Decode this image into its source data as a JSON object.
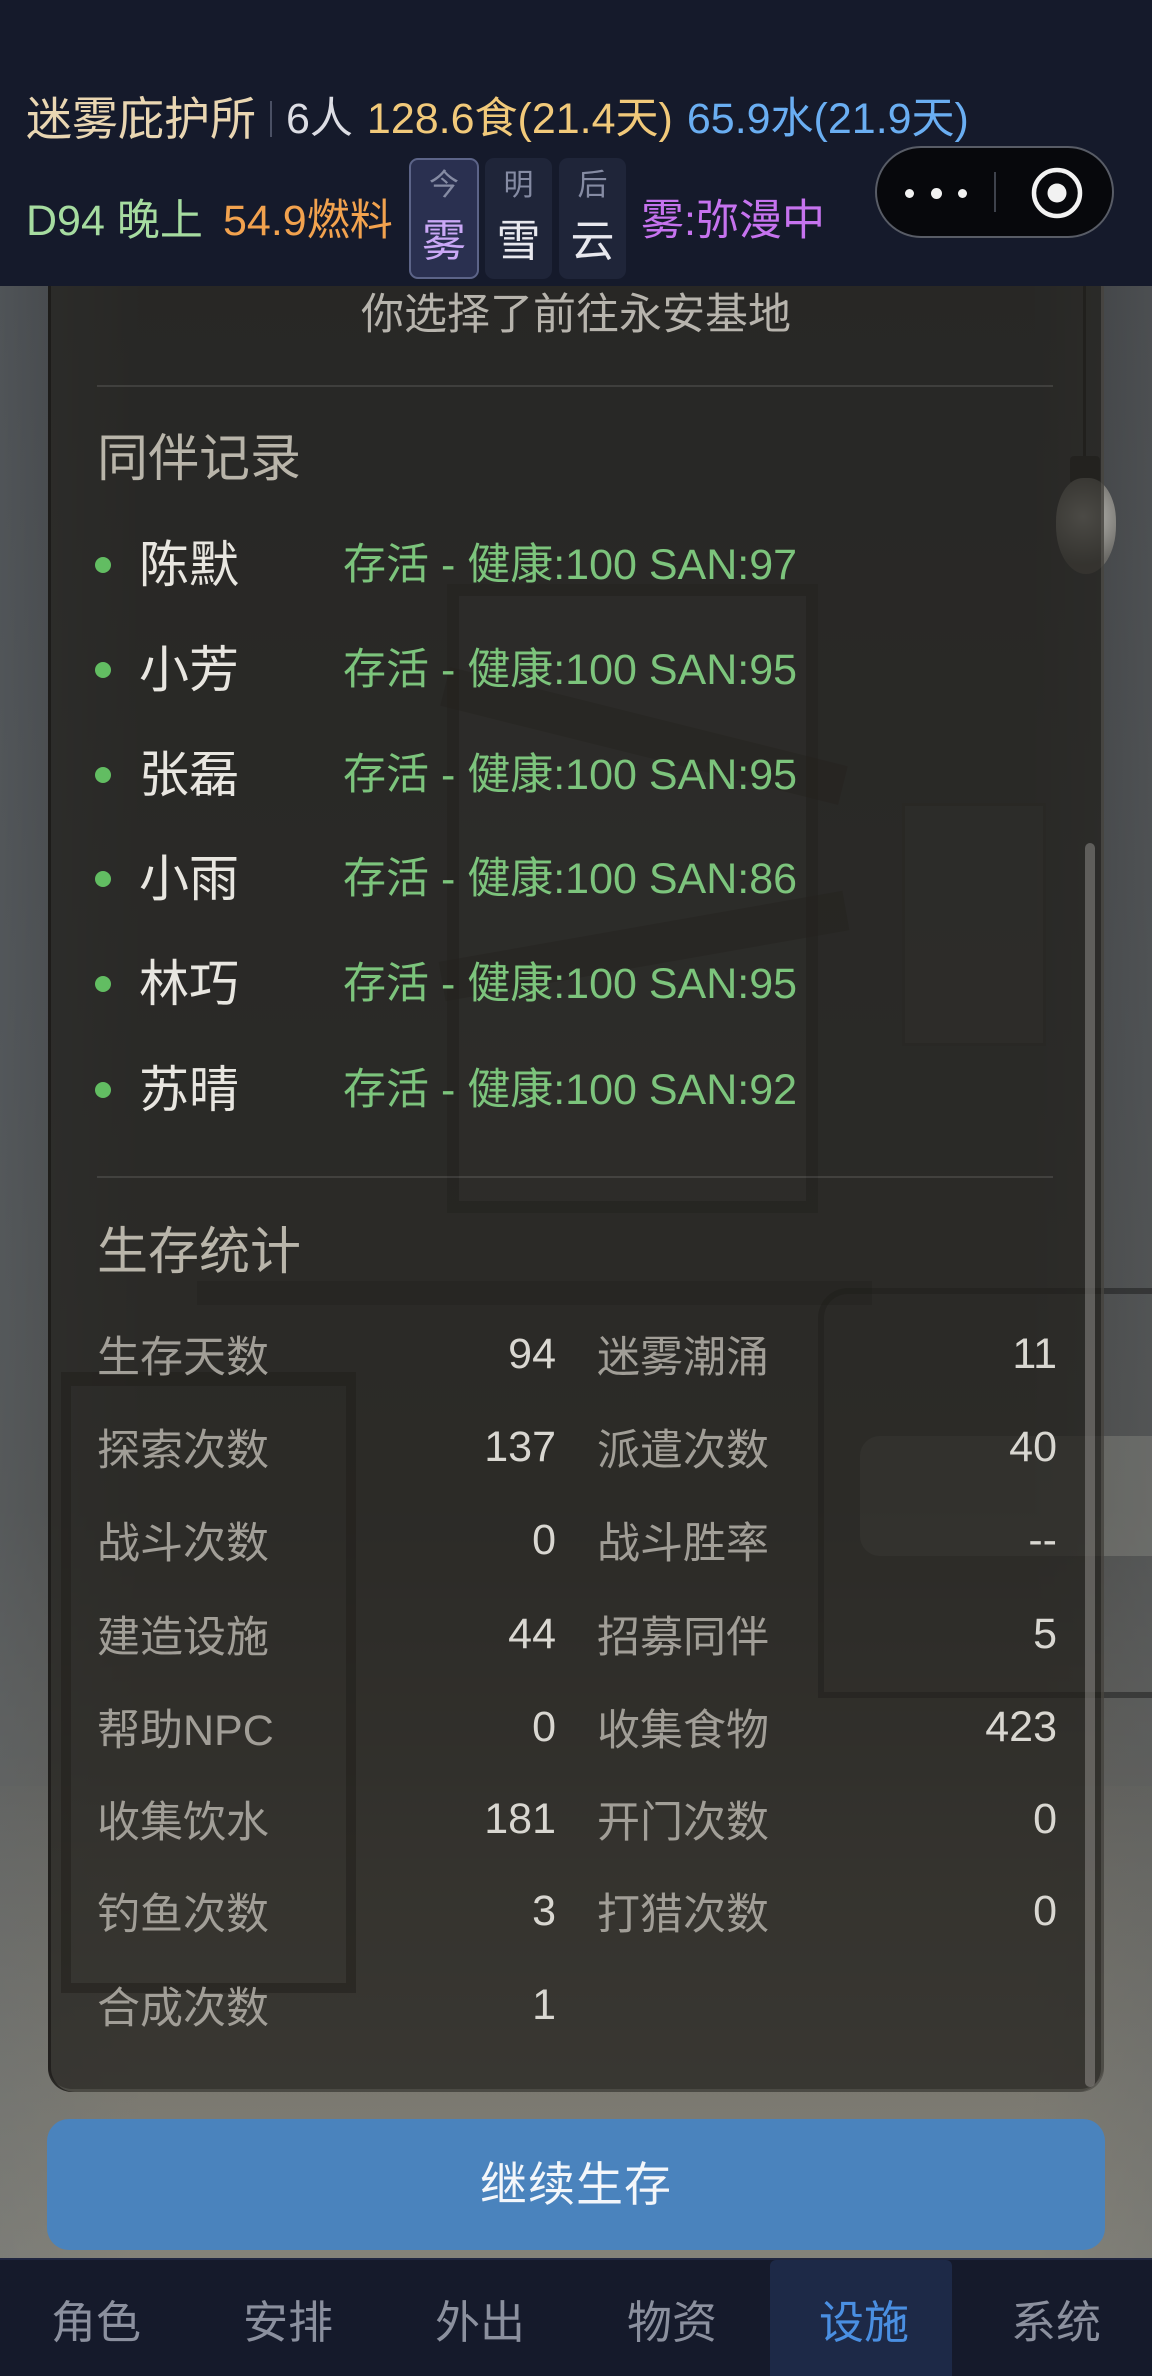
{
  "header": {
    "title": "迷雾庇护所",
    "population": "6人",
    "food": "128.6食(21.4天)",
    "water": "65.9水(21.9天)",
    "day_time": "D94 晚上",
    "fuel": "54.9燃料",
    "forecast": [
      {
        "label": "今",
        "weather": "雾",
        "active": true
      },
      {
        "label": "明",
        "weather": "雪",
        "active": false
      },
      {
        "label": "后",
        "weather": "云",
        "active": false
      }
    ],
    "fog_status": "雾:弥漫中"
  },
  "capsule": {
    "more_icon": "more-dots-icon",
    "record_icon": "target-circle-icon"
  },
  "panel": {
    "choice_text": "你选择了前往永安基地",
    "companions_heading": "同伴记录",
    "companions": [
      {
        "name": "陈默",
        "status": "存活 - 健康:100 SAN:97"
      },
      {
        "name": "小芳",
        "status": "存活 - 健康:100 SAN:95"
      },
      {
        "name": "张磊",
        "status": "存活 - 健康:100 SAN:95"
      },
      {
        "name": "小雨",
        "status": "存活 - 健康:100 SAN:86"
      },
      {
        "name": "林巧",
        "status": "存活 - 健康:100 SAN:95"
      },
      {
        "name": "苏晴",
        "status": "存活 - 健康:100 SAN:92"
      }
    ],
    "stats_heading": "生存统计",
    "stats": [
      {
        "label": "生存天数",
        "value": "94"
      },
      {
        "label": "迷雾潮涌",
        "value": "11"
      },
      {
        "label": "探索次数",
        "value": "137"
      },
      {
        "label": "派遣次数",
        "value": "40"
      },
      {
        "label": "战斗次数",
        "value": "0"
      },
      {
        "label": "战斗胜率",
        "value": "--"
      },
      {
        "label": "建造设施",
        "value": "44"
      },
      {
        "label": "招募同伴",
        "value": "5"
      },
      {
        "label": "帮助NPC",
        "value": "0"
      },
      {
        "label": "收集食物",
        "value": "423"
      },
      {
        "label": "收集饮水",
        "value": "181"
      },
      {
        "label": "开门次数",
        "value": "0"
      },
      {
        "label": "钓鱼次数",
        "value": "3"
      },
      {
        "label": "打猎次数",
        "value": "0"
      },
      {
        "label": "合成次数",
        "value": "1"
      }
    ]
  },
  "continue_button": "继续生存",
  "tabs": [
    {
      "label": "角色",
      "active": false
    },
    {
      "label": "安排",
      "active": false
    },
    {
      "label": "外出",
      "active": false
    },
    {
      "label": "物资",
      "active": false
    },
    {
      "label": "设施",
      "active": true
    },
    {
      "label": "系统",
      "active": false
    }
  ],
  "colors": {
    "header_bg": "#151a2b",
    "title": "#e9d6b2",
    "food": "#f1c97a",
    "water": "#6aaef2",
    "day_time": "#a6dca0",
    "fuel": "#f2a24e",
    "fog": "#c673ef",
    "active_weather": "#caa8f6",
    "alive": "#7cc47c",
    "button": "#4a83bd",
    "tab_active": "#4a8fe2",
    "tab_active_bg": "#1d2947"
  }
}
